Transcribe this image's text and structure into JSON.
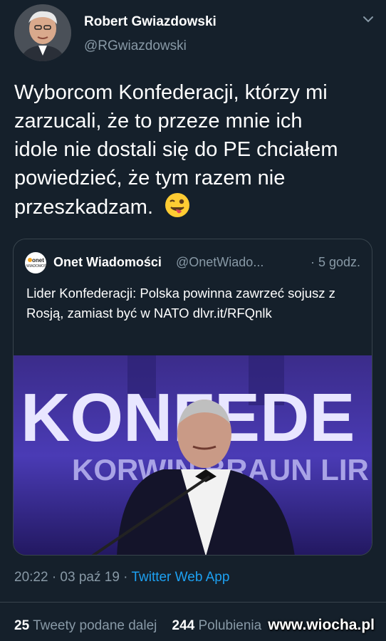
{
  "author": {
    "name": "Robert Gwiazdowski",
    "handle": "@RGwiazdowski"
  },
  "tweet": {
    "text": "Wyborcom Konfederacji, którzy mi zarzucali, że to przeze mnie ich idole nie dostali się do PE chciałem powiedzieć, że tym razem nie przeszkadzam.",
    "emoji": "winking-face-with-tongue"
  },
  "quoted": {
    "logo_text": "onet",
    "logo_subtext": "WIADOMOŚCI",
    "name": "Onet Wiadomości",
    "handle": "@OnetWiado...",
    "time": "· 5 godz.",
    "text": "Lider Konfederacji: Polska powinna zawrzeć sojusz z Rosją, zamiast być w NATO dlvr.it/RFQnlk",
    "image": {
      "banner_line1": "KONFEDE",
      "banner_line2": "KORWIN BRAUN LIR"
    }
  },
  "meta": {
    "time": "20:22 · 03 paź 19 · ",
    "app": "Twitter Web App"
  },
  "stats": {
    "retweets_count": "25",
    "retweets_label": "Tweety podane dalej",
    "likes_count": "244",
    "likes_label": "Polubienia"
  },
  "watermark": "www.wiocha.pl",
  "colors": {
    "background": "#15202b",
    "text_secondary": "#8899a6",
    "link": "#1da1f2",
    "border": "#38444d"
  }
}
